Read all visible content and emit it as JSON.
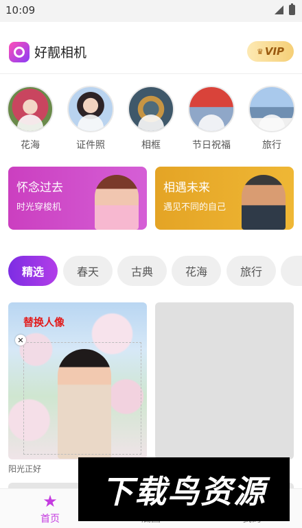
{
  "status_bar": {
    "time": "10:09"
  },
  "header": {
    "app_name": "好靓相机",
    "vip_label": "VIP"
  },
  "categories": [
    {
      "label": "花海"
    },
    {
      "label": "证件照"
    },
    {
      "label": "相框"
    },
    {
      "label": "节日祝福"
    },
    {
      "label": "旅行"
    }
  ],
  "banners": [
    {
      "title": "怀念过去",
      "subtitle": "时光穿梭机"
    },
    {
      "title": "相遇未来",
      "subtitle": "遇见不同的自己"
    }
  ],
  "filters": [
    {
      "label": "精选",
      "active": true
    },
    {
      "label": "春天"
    },
    {
      "label": "古典"
    },
    {
      "label": "花海"
    },
    {
      "label": "旅行"
    }
  ],
  "template_card": {
    "overlay_label": "替换人像",
    "caption": "阳光正好"
  },
  "bottom_nav": [
    {
      "label": "首页",
      "icon": "star-face-icon",
      "active": true
    },
    {
      "label": "底图",
      "icon": "image-icon"
    },
    {
      "label": "我的",
      "icon": "user-icon"
    }
  ],
  "watermark": {
    "text": "下载鸟资源"
  },
  "colors": {
    "accent": "#c43be0",
    "banner_left": "#cb3fc0",
    "banner_right": "#e4a425",
    "active_chip": "#7d2de3",
    "vip_text": "#9a5a10"
  }
}
